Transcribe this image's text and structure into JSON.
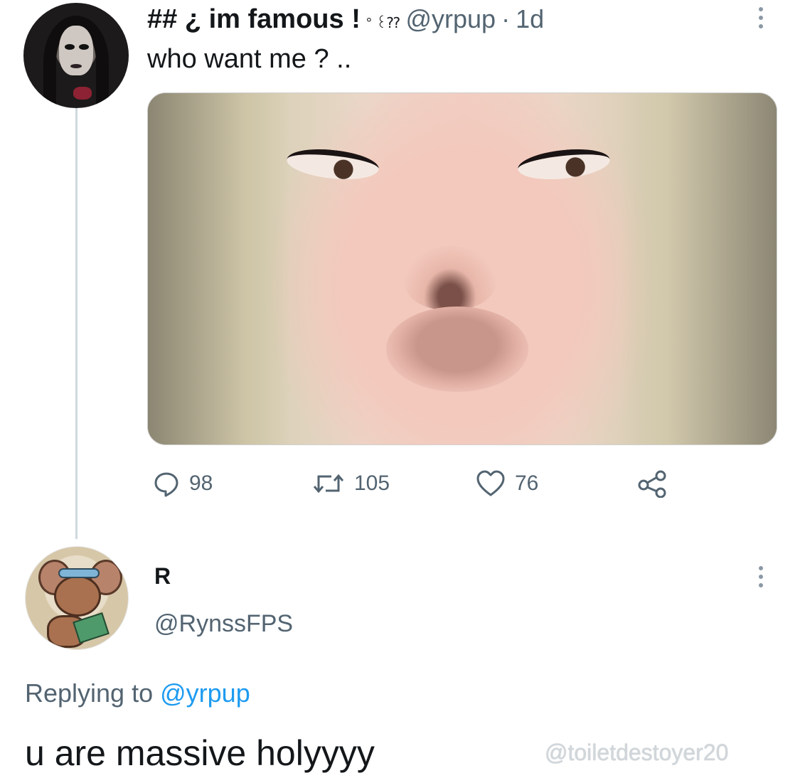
{
  "tweet": {
    "display_name": "## ¿ im famous !",
    "name_decoration": "° ꒰⁇",
    "handle": "@yrpup",
    "separator": "·",
    "time": "1d",
    "text": "who want me ? ..",
    "avatar_icon": "goth-girl-avatar",
    "more_icon": "more-vertical-icon",
    "stats": {
      "replies": "98",
      "retweets": "105",
      "likes": "76"
    },
    "icons": {
      "reply": "comment-bubble-icon",
      "retweet": "retweet-arrows-icon",
      "like": "heart-icon",
      "share": "share-nodes-icon"
    }
  },
  "reply": {
    "display_name": "R",
    "handle": "@RynssFPS",
    "replying_prefix": "Replying to",
    "replying_mention": "@yrpup",
    "text": "u are massive holyyyy",
    "avatar_icon": "cartoon-mouse-avatar",
    "more_icon": "more-vertical-icon"
  },
  "watermark": "@toiletdestoyer20",
  "colors": {
    "text": "#14171a",
    "secondary": "#536471",
    "accent": "#1d9bf0",
    "thread_line": "#cfd9de"
  }
}
